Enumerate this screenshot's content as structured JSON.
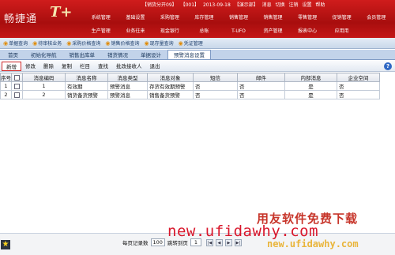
{
  "app": {
    "logo_text": "畅捷通",
    "logo_mark": "T+",
    "info_items": [
      "【销货分开09】",
      "【001】",
      "2013-09-18",
      "【演示部】",
      "消息",
      "切换",
      "注销",
      "设置",
      "帮助"
    ]
  },
  "main_nav": [
    "系统管理",
    "基础设置",
    "采购管理",
    "库存管理",
    "销售管理",
    "销售管理",
    "零售管理",
    "促销管理",
    "会员管理",
    "生产管理",
    "业务往来",
    "现金银行",
    "总账",
    "T-UFO",
    "资产管理",
    "报表中心",
    "应用用",
    ""
  ],
  "quick_bar": [
    "单据查询",
    "待审核业务",
    "采购价格查询",
    "销售价格查询",
    "现存量查询",
    "凭证管理"
  ],
  "tabs": [
    "首页",
    "初始化导航",
    "销售出库单",
    "销货情况",
    "单据设计",
    "预警消息设置"
  ],
  "toolbar": [
    "新增",
    "修改",
    "删除",
    "复制",
    "栏目",
    "查找",
    "批改接收人",
    "退出"
  ],
  "table": {
    "headers": [
      "序号",
      "",
      "消息编码",
      "消息名称",
      "消息类型",
      "消息对象",
      "短信",
      "邮件",
      "内部消息",
      "企业空间"
    ],
    "rows": [
      [
        "1",
        "",
        "1",
        "有效期",
        "预警消息",
        "存货有效期预警",
        "否",
        "否",
        "是",
        "否"
      ],
      [
        "2",
        "",
        "2",
        "销货备货预警",
        "预警消息",
        "销售备货预警",
        "否",
        "否",
        "是",
        "否"
      ]
    ]
  },
  "status": {
    "page_size_label": "每页记录数",
    "page_size": "100",
    "jump_label": "跳转到页",
    "jump_page": "1"
  },
  "watermark": {
    "url": "new.ufidawhy.com",
    "slogan": "用友软件免费下载",
    "url2": "new.ufidawhy.com"
  },
  "colors": {
    "header_red": "#b81414",
    "accent_blue": "#2e67c4",
    "selected_button_border": "#d12a2a"
  }
}
